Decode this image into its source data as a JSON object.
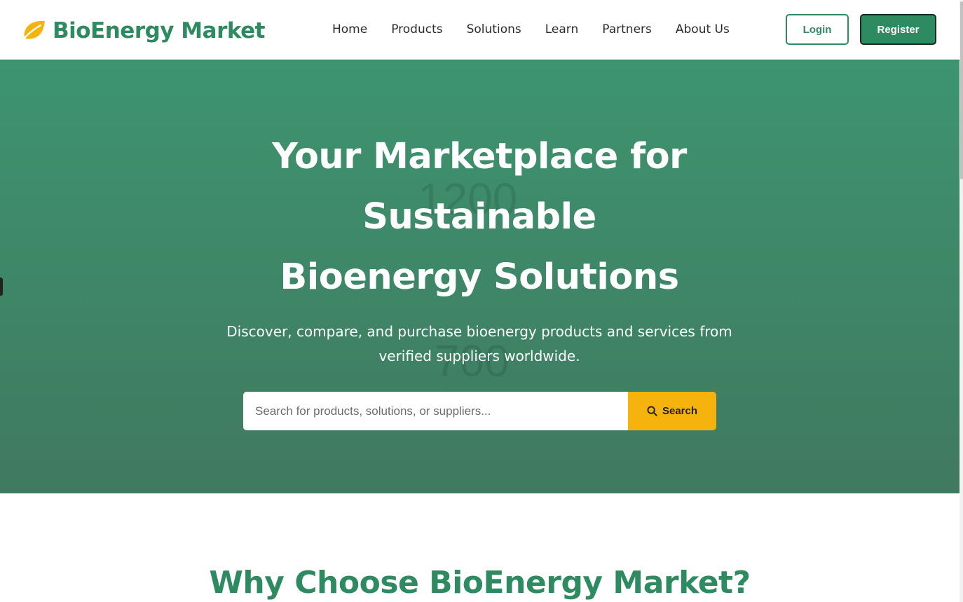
{
  "header": {
    "logo_text": "BioEnergy Market",
    "logo_icon": "leaf-icon",
    "nav": [
      "Home",
      "Products",
      "Solutions",
      "Learn",
      "Partners",
      "About Us"
    ],
    "login_label": "Login",
    "register_label": "Register"
  },
  "hero": {
    "title": "Your Marketplace for Sustainable Bioenergy Solutions",
    "subtitle": "Discover, compare, and purchase bioenergy products and services from verified suppliers worldwide.",
    "search_placeholder": "Search for products, solutions, or suppliers...",
    "search_button": "Search",
    "search_icon": "search-icon",
    "background_numbers": [
      "1200",
      "700"
    ]
  },
  "why": {
    "title": "Why Choose BioEnergy Market?"
  },
  "colors": {
    "brand_green": "#2e8b61",
    "accent_yellow": "#f7b30d",
    "hero_top": "#3d9470",
    "hero_bottom": "#40795f"
  }
}
